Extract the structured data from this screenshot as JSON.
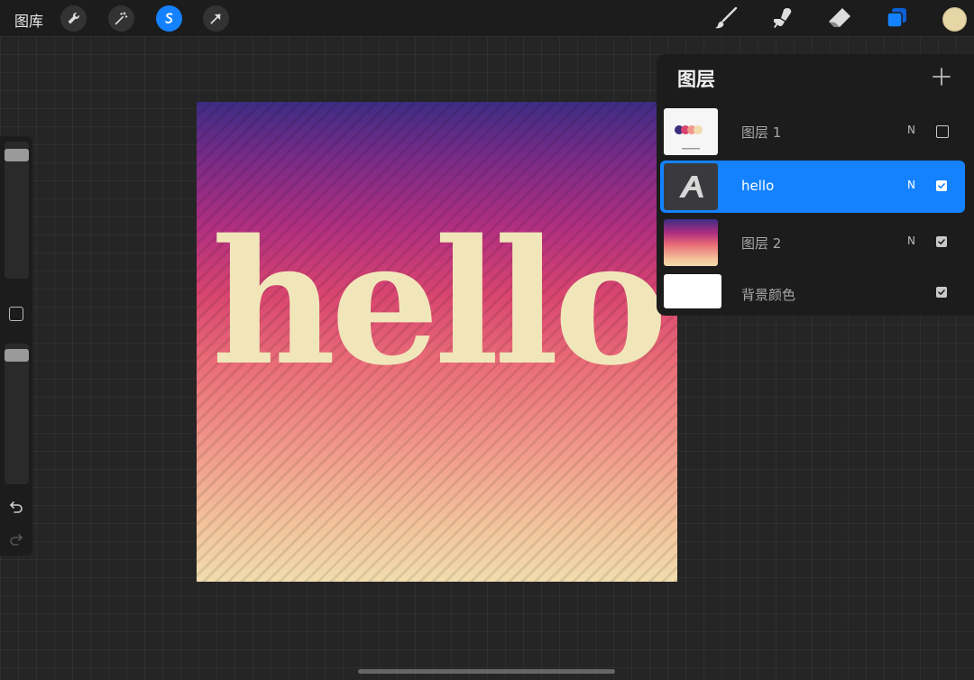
{
  "topbar": {
    "gallery_label": "图库",
    "tools_left": [
      "wrench-icon",
      "magic-wand-icon",
      "selection-icon",
      "arrow-icon"
    ],
    "tools_right": [
      "brush-icon",
      "smudge-icon",
      "eraser-icon",
      "layers-icon"
    ],
    "active_left_tool": "selection-icon",
    "active_right_tool": "layers-icon",
    "current_color": "#e6d6a6",
    "accent_color": "#1482ff"
  },
  "canvas": {
    "text": "hello",
    "text_color": "#f1e6ba"
  },
  "layers_panel": {
    "title": "图层",
    "add_icon": "plus-icon",
    "layers": [
      {
        "name": "图层 1",
        "blend": "N",
        "visible": false,
        "selected": false
      },
      {
        "name": "hello",
        "blend": "N",
        "visible": true,
        "selected": true
      },
      {
        "name": "图层 2",
        "blend": "N",
        "visible": true,
        "selected": false
      },
      {
        "name": "背景颜色",
        "blend": "",
        "visible": true,
        "selected": false
      }
    ]
  },
  "sidebar": {
    "icons": [
      "brush-size-slider",
      "modify-icon",
      "opacity-slider",
      "undo-icon",
      "redo-icon"
    ]
  }
}
